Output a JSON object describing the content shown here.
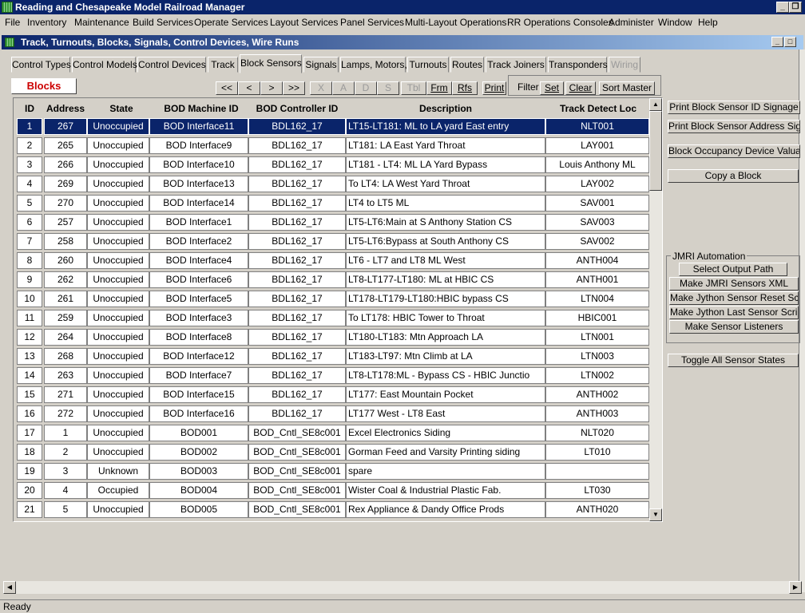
{
  "app": {
    "title": "Reading and Chesapeake Model Railroad Manager"
  },
  "menu": [
    "File",
    "Inventory",
    "Maintenance",
    "Build Services",
    "Operate Services",
    "Layout Services",
    "Panel Services",
    "Multi-Layout Operations",
    "RR Operations Consoles",
    "Administer",
    "Window",
    "Help"
  ],
  "child_window": {
    "title": "Track, Turnouts, Blocks, Signals, Control Devices, Wire Runs"
  },
  "tabs": [
    "Control Types",
    "Control Models",
    "Control Devices",
    "Track",
    "Block Sensors",
    "Signals",
    "Lamps, Motors,",
    "Turnouts",
    "Routes",
    "Track Joiners",
    "Transponders",
    "Wiring"
  ],
  "active_tab": "Block Sensors",
  "section_label": "Blocks",
  "nav_buttons": [
    "<<",
    "<",
    ">",
    ">>"
  ],
  "edit_buttons": [
    "X",
    "A",
    "D",
    "S",
    "Tbl",
    "Frm",
    "Rfs"
  ],
  "print_label": "Print",
  "filter": {
    "label": "Filter",
    "set": "Set",
    "clear": "Clear"
  },
  "sort_master": "Sort Master",
  "columns": [
    "ID",
    "Address",
    "State",
    "BOD Machine ID",
    "BOD Controller ID",
    "Description",
    "Track Detect Loc"
  ],
  "rows": [
    [
      "1",
      "267",
      "Unoccupied",
      "BOD Interface11",
      "BDL162_17",
      "LT15-LT181: ML to LA yard East entry",
      "NLT001"
    ],
    [
      "2",
      "265",
      "Unoccupied",
      "BOD Interface9",
      "BDL162_17",
      "LT181: LA East Yard Throat",
      "LAY001"
    ],
    [
      "3",
      "266",
      "Unoccupied",
      "BOD Interface10",
      "BDL162_17",
      "LT181 - LT4: ML LA Yard Bypass",
      "Louis Anthony ML"
    ],
    [
      "4",
      "269",
      "Unoccupied",
      "BOD Interface13",
      "BDL162_17",
      "To LT4: LA West Yard Throat",
      "LAY002"
    ],
    [
      "5",
      "270",
      "Unoccupied",
      "BOD Interface14",
      "BDL162_17",
      "LT4 to LT5 ML",
      "SAV001"
    ],
    [
      "6",
      "257",
      "Unoccupied",
      "BOD Interface1",
      "BDL162_17",
      "LT5-LT6:Main at S Anthony Station CS",
      "SAV003"
    ],
    [
      "7",
      "258",
      "Unoccupied",
      "BOD Interface2",
      "BDL162_17",
      "LT5-LT6:Bypass at South Anthony CS",
      "SAV002"
    ],
    [
      "8",
      "260",
      "Unoccupied",
      "BOD Interface4",
      "BDL162_17",
      "LT6 - LT7 and LT8 ML West",
      "ANTH004"
    ],
    [
      "9",
      "262",
      "Unoccupied",
      "BOD Interface6",
      "BDL162_17",
      "LT8-LT177-LT180: ML at HBIC CS",
      "ANTH001"
    ],
    [
      "10",
      "261",
      "Unoccupied",
      "BOD Interface5",
      "BDL162_17",
      "LT178-LT179-LT180:HBIC bypass CS",
      "LTN004"
    ],
    [
      "11",
      "259",
      "Unoccupied",
      "BOD Interface3",
      "BDL162_17",
      "To LT178: HBIC Tower to Throat",
      "HBIC001"
    ],
    [
      "12",
      "264",
      "Unoccupied",
      "BOD Interface8",
      "BDL162_17",
      "LT180-LT183: Mtn Approach LA",
      "LTN001"
    ],
    [
      "13",
      "268",
      "Unoccupied",
      "BOD Interface12",
      "BDL162_17",
      "LT183-LT97: Mtn Climb at LA",
      "LTN003"
    ],
    [
      "14",
      "263",
      "Unoccupied",
      "BOD Interface7",
      "BDL162_17",
      "LT8-LT178:ML - Bypass CS - HBIC Junctio",
      "LTN002"
    ],
    [
      "15",
      "271",
      "Unoccupied",
      "BOD Interface15",
      "BDL162_17",
      "LT177: East Mountain Pocket",
      "ANTH002"
    ],
    [
      "16",
      "272",
      "Unoccupied",
      "BOD Interface16",
      "BDL162_17",
      "LT177 West - LT8 East",
      "ANTH003"
    ],
    [
      "17",
      "1",
      "Unoccupied",
      "BOD001",
      "BOD_Cntl_SE8c001",
      "Excel Electronics Siding",
      "NLT020"
    ],
    [
      "18",
      "2",
      "Unoccupied",
      "BOD002",
      "BOD_Cntl_SE8c001",
      "Gorman Feed and Varsity Printing siding",
      "LT010"
    ],
    [
      "19",
      "3",
      "Unknown",
      "BOD003",
      "BOD_Cntl_SE8c001",
      "spare",
      ""
    ],
    [
      "20",
      "4",
      "Occupied",
      "BOD004",
      "BOD_Cntl_SE8c001",
      "Wister Coal & Industrial Plastic Fab.",
      "LT030"
    ],
    [
      "21",
      "5",
      "Unoccupied",
      "BOD005",
      "BOD_Cntl_SE8c001",
      "Rex Appliance & Dandy Office Prods",
      "ANTH020"
    ]
  ],
  "selected_row": 0,
  "side_buttons": [
    "Print Block Sensor ID Signage",
    "Print Block Sensor Address Signage",
    "Block Occupancy Device Valuation",
    "Copy a Block"
  ],
  "jmri": {
    "title": "JMRI Automation",
    "buttons": [
      "Select Output Path",
      "Make JMRI Sensors XML",
      "Make Jython Sensor Reset Script",
      "Make Jython Last Sensor Script",
      "Make Sensor Listeners"
    ]
  },
  "toggle_button": "Toggle All Sensor States",
  "status": "Ready",
  "colors": {
    "titlebar": "#0a246a",
    "selection": "#0a246a",
    "section_label": "#cc0000"
  }
}
